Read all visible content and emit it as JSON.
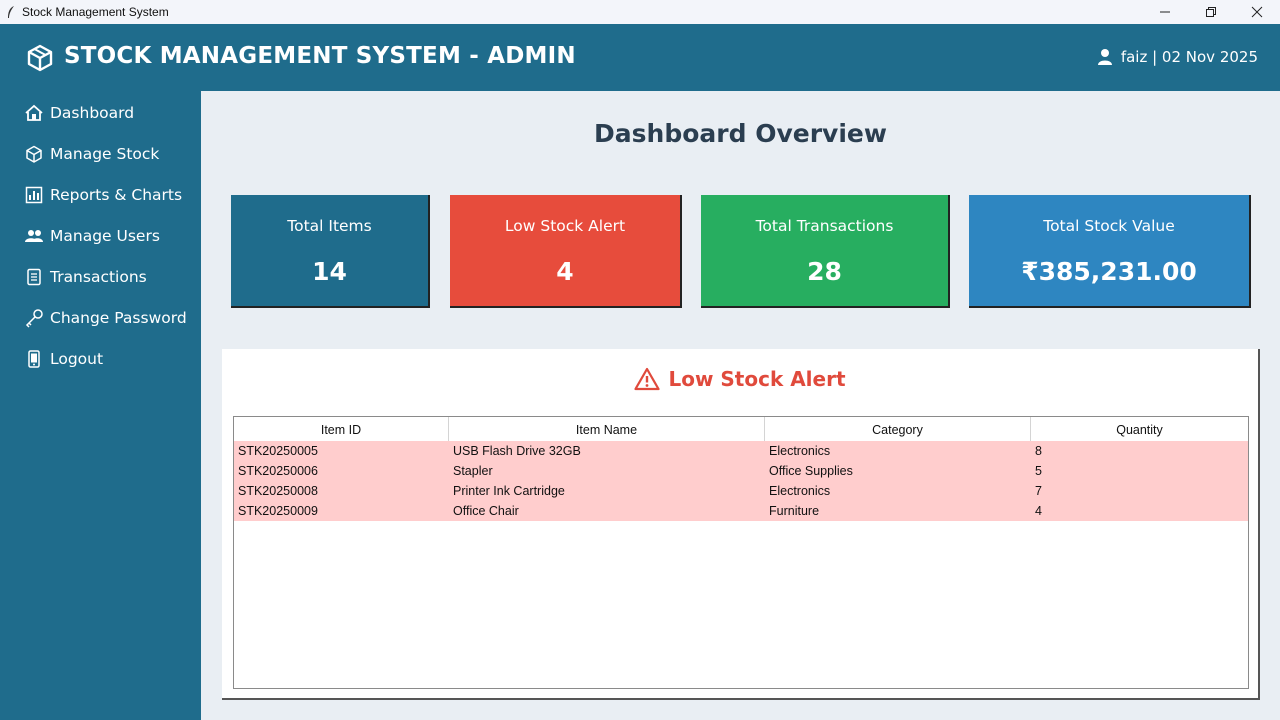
{
  "window": {
    "title": "Stock Management System",
    "icons": [
      "feather-icon",
      "minimize-icon",
      "restore-icon",
      "close-icon"
    ]
  },
  "header": {
    "title": "STOCK MANAGEMENT SYSTEM - ADMIN",
    "user_text": "faiz | 02 Nov 2025",
    "logo_icon": "cube-icon",
    "user_icon": "user-icon"
  },
  "sidebar": {
    "items": [
      {
        "label": "Dashboard",
        "icon": "house-icon"
      },
      {
        "label": "Manage Stock",
        "icon": "cube-icon"
      },
      {
        "label": "Reports & Charts",
        "icon": "bar-chart-icon"
      },
      {
        "label": "Manage Users",
        "icon": "users-icon"
      },
      {
        "label": "Transactions",
        "icon": "receipt-icon"
      },
      {
        "label": "Change Password",
        "icon": "key-icon"
      },
      {
        "label": "Logout",
        "icon": "phone-icon"
      }
    ]
  },
  "main": {
    "page_title": "Dashboard Overview",
    "cards": [
      {
        "label": "Total Items",
        "value": "14",
        "color": "#1f6c8c"
      },
      {
        "label": "Low Stock Alert",
        "value": "4",
        "color": "#e74c3c"
      },
      {
        "label": "Total Transactions",
        "value": "28",
        "color": "#27ae60"
      },
      {
        "label": "Total Stock Value",
        "value": "₹385,231.00",
        "color": "#2e86c1"
      }
    ],
    "alert": {
      "title": "Low Stock Alert",
      "icon": "warning-icon",
      "columns": [
        "Item ID",
        "Item Name",
        "Category",
        "Quantity"
      ],
      "rows": [
        [
          "STK20250005",
          "USB Flash Drive 32GB",
          "Electronics",
          "8"
        ],
        [
          "STK20250006",
          "Stapler",
          "Office Supplies",
          "5"
        ],
        [
          "STK20250008",
          "Printer Ink Cartridge",
          "Electronics",
          "7"
        ],
        [
          "STK20250009",
          "Office Chair",
          "Furniture",
          "4"
        ]
      ],
      "row_color": "#ffcdcd"
    }
  },
  "colors": {
    "header_bg": "#1f6c8c",
    "main_bg": "#e9eef3",
    "title_color": "#2b3e50",
    "alert_title_color": "#e04a3c"
  }
}
